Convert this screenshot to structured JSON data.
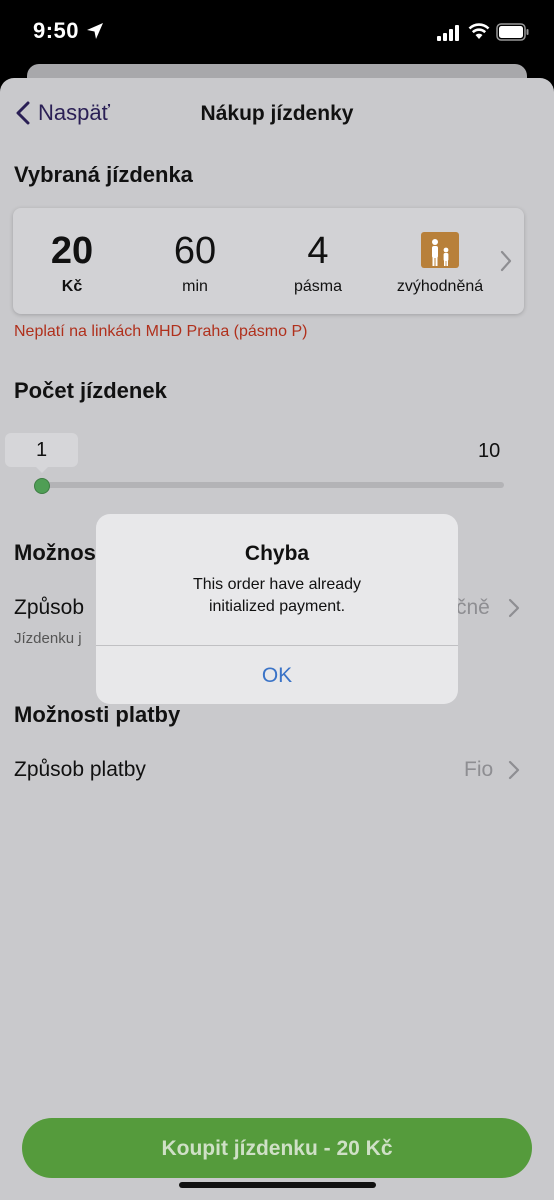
{
  "status_bar": {
    "time": "9:50"
  },
  "nav": {
    "back_label": "Naspäť",
    "title": "Nákup jízdenky"
  },
  "selected_ticket": {
    "heading": "Vybraná jízdenka",
    "price_value": "20",
    "price_unit": "Kč",
    "duration_value": "60",
    "duration_unit": "min",
    "zones_value": "4",
    "zones_unit": "pásma",
    "tariff_label": "zvýhodněná",
    "warning": "Neplatí na linkách MHD Praha (pásmo P)"
  },
  "ticket_count": {
    "heading": "Počet jízdenek",
    "current": "1",
    "max": "10",
    "fraction": 0.0
  },
  "delivery_options": {
    "heading_partial": "Možnos",
    "method_label_partial": "Způsob",
    "method_value_partial": "čně",
    "sub_partial": "Jízdenku j"
  },
  "payment_options": {
    "heading": "Možnosti platby",
    "method_label": "Způsob platby",
    "method_value": "Fio"
  },
  "buy_button": {
    "label": "Koupit jízdenku - 20 Kč"
  },
  "alert": {
    "title": "Chyba",
    "message_line1": "This order have already",
    "message_line2": "initialized payment.",
    "ok_label": "OK"
  },
  "colors": {
    "accent_green": "#559b3c",
    "warning_red": "#b0301c",
    "link_blue": "#3a73c7",
    "nav_purple": "#2a1f55",
    "tariff_icon": "#b8803a"
  }
}
